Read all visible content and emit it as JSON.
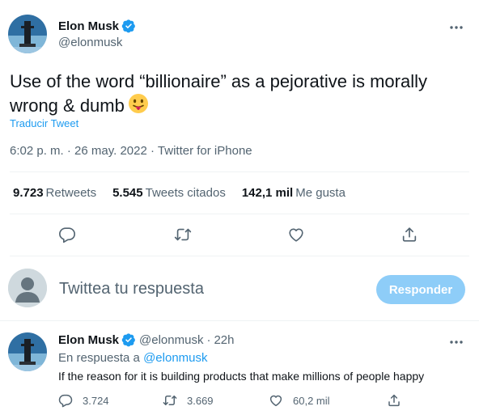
{
  "main_tweet": {
    "author_name": "Elon Musk",
    "author_handle": "@elonmusk",
    "text": "Use of the word “billionaire” as a pejorative is morally wrong & dumb",
    "emoji_icon": "face-with-tongue-emoji",
    "translate_link": "Traducir Tweet",
    "time": "6:02 p. m.",
    "date": "26 may. 2022",
    "source": "Twitter for iPhone",
    "separator": "·",
    "stats": {
      "retweets_count": "9.723",
      "retweets_label": "Retweets",
      "quotes_count": "5.545",
      "quotes_label": "Tweets citados",
      "likes_count": "142,1 mil",
      "likes_label": "Me gusta"
    },
    "actions": [
      "reply-icon",
      "retweet-icon",
      "like-icon",
      "share-icon"
    ]
  },
  "composer": {
    "placeholder": "Twittea tu respuesta",
    "button_label": "Responder"
  },
  "reply_tweet": {
    "author_name": "Elon Musk",
    "author_handle": "@elonmusk",
    "time_ago": "22h",
    "separator": "·",
    "in_reply_prefix": "En respuesta a",
    "in_reply_mention": "@elonmusk",
    "text": "If the reason for it is building products that make millions of people happy",
    "replies": "3.724",
    "retweets": "3.669",
    "likes": "60,2 mil"
  },
  "colors": {
    "accent": "#1d9bf0",
    "secondary_text": "#536471",
    "primary_text": "#0f1419",
    "disabled_button": "#8ecdf8",
    "divider": "#eff3f4"
  }
}
